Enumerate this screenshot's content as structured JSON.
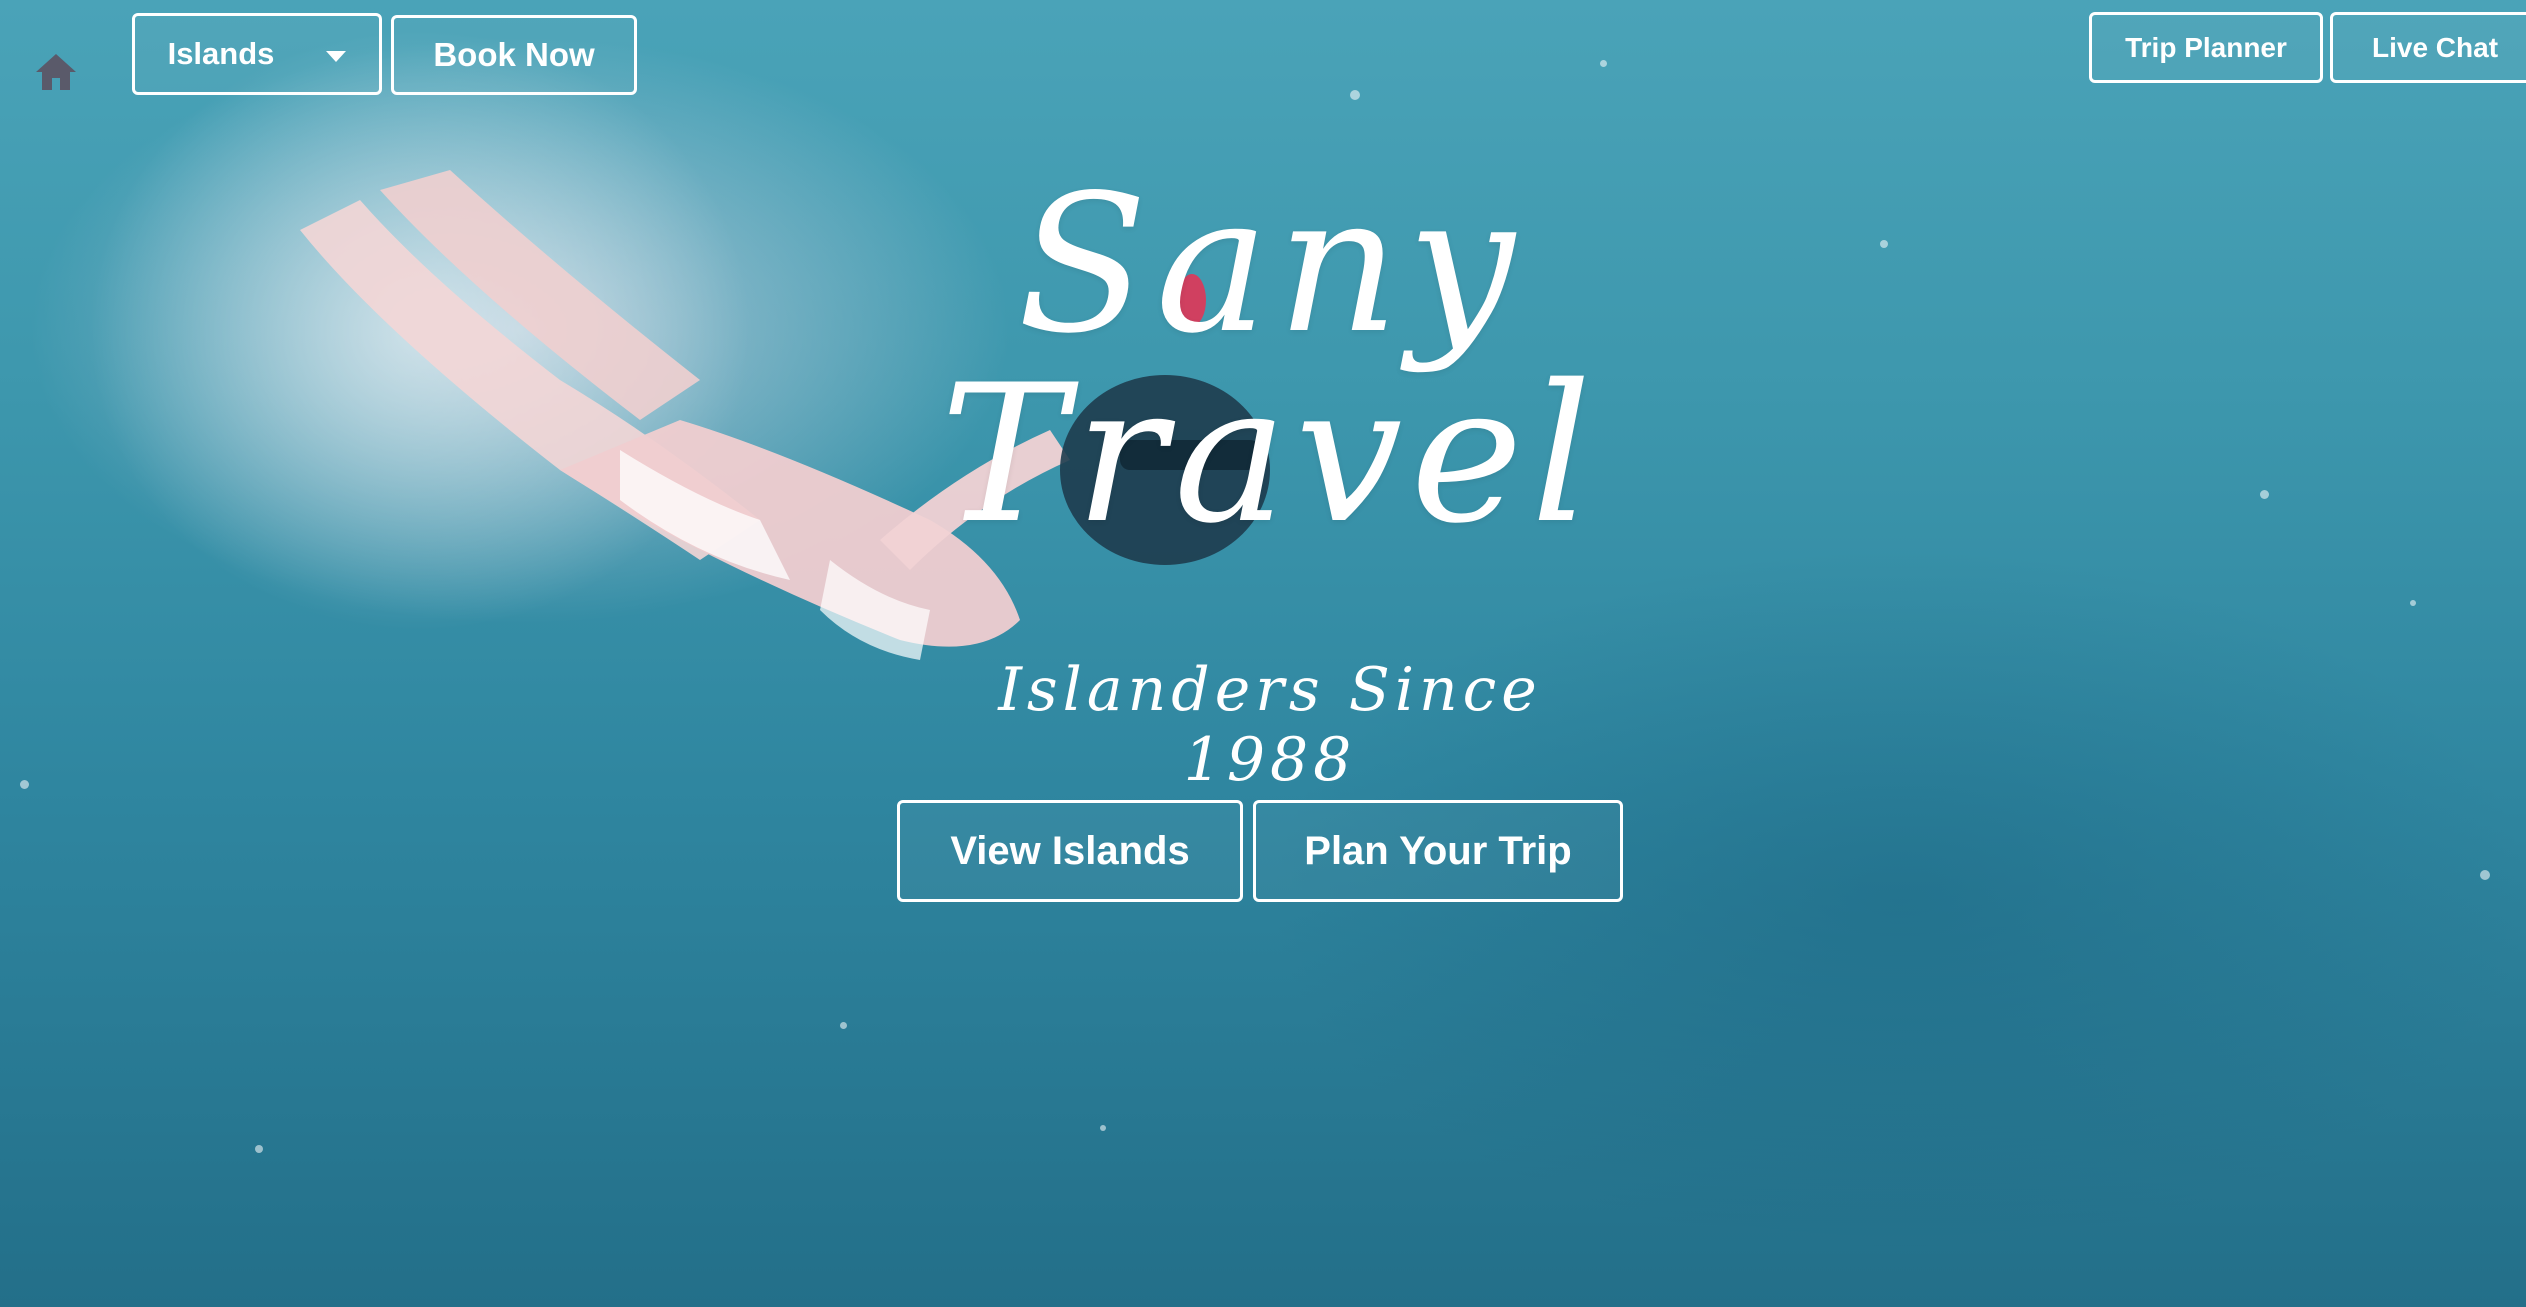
{
  "nav": {
    "home_icon": "home-icon",
    "islands_label": "Islands",
    "book_now_label": "Book Now",
    "trip_planner_label": "Trip Planner",
    "live_chat_label": "Live Chat"
  },
  "hero": {
    "title": "Sany Travel",
    "tagline": "Islanders Since 1988",
    "view_islands_label": "View Islands",
    "plan_trip_label": "Plan Your Trip"
  },
  "colors": {
    "water_top": "#4aa3b8",
    "water_bottom": "#236f89",
    "text": "#ffffff",
    "home_icon": "#5a5a6a"
  }
}
